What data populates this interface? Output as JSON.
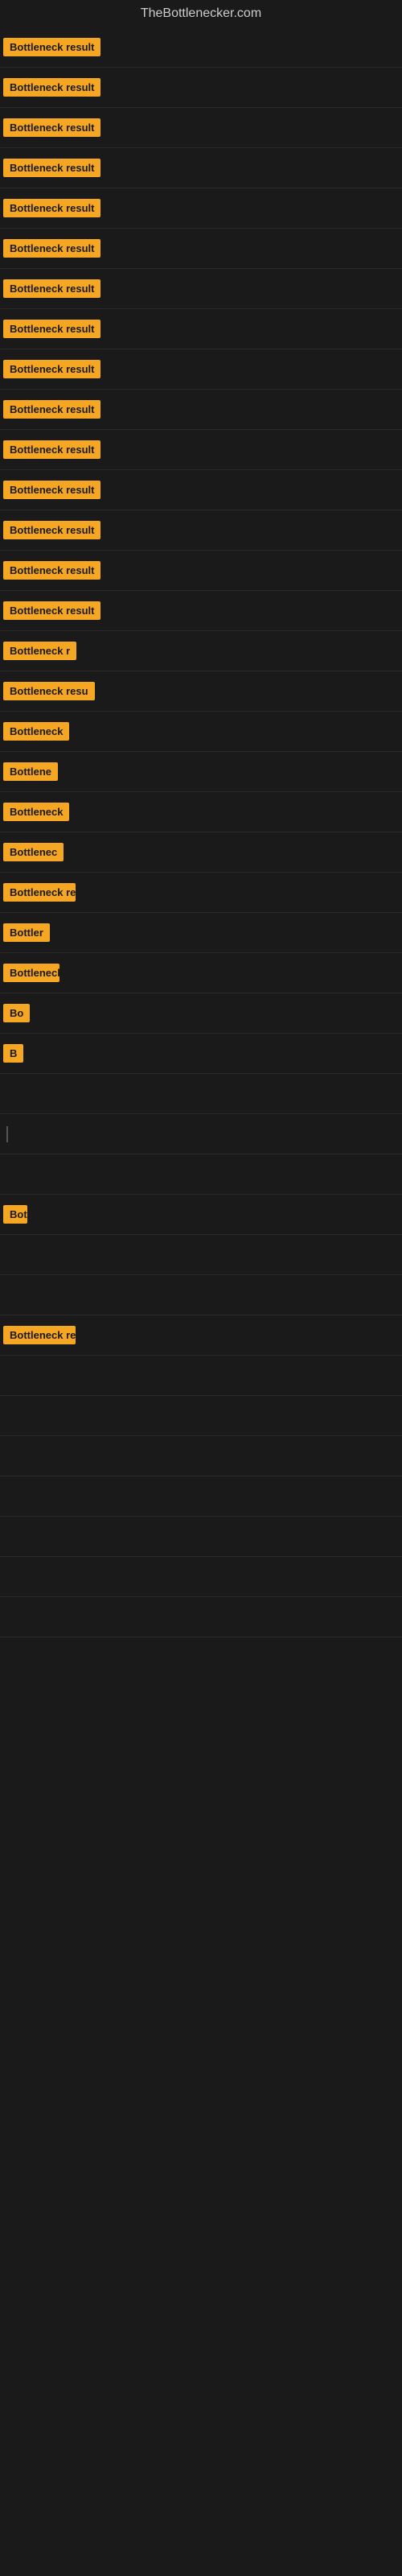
{
  "site": {
    "title": "TheBottlenecker.com"
  },
  "rows": [
    {
      "id": 1,
      "label": "Bottleneck result",
      "labelClass": "label-full",
      "barWidth": 0
    },
    {
      "id": 2,
      "label": "Bottleneck result",
      "labelClass": "label-full",
      "barWidth": 0
    },
    {
      "id": 3,
      "label": "Bottleneck result",
      "labelClass": "label-full",
      "barWidth": 0
    },
    {
      "id": 4,
      "label": "Bottleneck result",
      "labelClass": "label-full",
      "barWidth": 0
    },
    {
      "id": 5,
      "label": "Bottleneck result",
      "labelClass": "label-full",
      "barWidth": 0
    },
    {
      "id": 6,
      "label": "Bottleneck result",
      "labelClass": "label-full",
      "barWidth": 0
    },
    {
      "id": 7,
      "label": "Bottleneck result",
      "labelClass": "label-full",
      "barWidth": 0
    },
    {
      "id": 8,
      "label": "Bottleneck result",
      "labelClass": "label-full",
      "barWidth": 0
    },
    {
      "id": 9,
      "label": "Bottleneck result",
      "labelClass": "label-full",
      "barWidth": 0
    },
    {
      "id": 10,
      "label": "Bottleneck result",
      "labelClass": "label-full",
      "barWidth": 0
    },
    {
      "id": 11,
      "label": "Bottleneck result",
      "labelClass": "label-full",
      "barWidth": 0
    },
    {
      "id": 12,
      "label": "Bottleneck result",
      "labelClass": "label-full",
      "barWidth": 0
    },
    {
      "id": 13,
      "label": "Bottleneck result",
      "labelClass": "label-full",
      "barWidth": 0
    },
    {
      "id": 14,
      "label": "Bottleneck result",
      "labelClass": "label-full",
      "barWidth": 0
    },
    {
      "id": 15,
      "label": "Bottleneck result",
      "labelClass": "label-full",
      "barWidth": 0
    },
    {
      "id": 16,
      "label": "Bottleneck r",
      "labelClass": "label-w1",
      "barWidth": 0
    },
    {
      "id": 17,
      "label": "Bottleneck resu",
      "labelClass": "label-w2",
      "barWidth": 0
    },
    {
      "id": 18,
      "label": "Bottleneck",
      "labelClass": "label-w3",
      "barWidth": 0
    },
    {
      "id": 19,
      "label": "Bottlene",
      "labelClass": "label-w4",
      "barWidth": 0
    },
    {
      "id": 20,
      "label": "Bottleneck",
      "labelClass": "label-w3",
      "barWidth": 0
    },
    {
      "id": 21,
      "label": "Bottlenec",
      "labelClass": "label-w5",
      "barWidth": 0
    },
    {
      "id": 22,
      "label": "Bottleneck re",
      "labelClass": "label-w6",
      "barWidth": 0
    },
    {
      "id": 23,
      "label": "Bottler",
      "labelClass": "label-w7",
      "barWidth": 0
    },
    {
      "id": 24,
      "label": "Bottleneck",
      "labelClass": "label-w8",
      "barWidth": 0
    },
    {
      "id": 25,
      "label": "Bo",
      "labelClass": "label-w9",
      "barWidth": 0
    },
    {
      "id": 26,
      "label": "B",
      "labelClass": "label-w10",
      "barWidth": 0
    },
    {
      "id": 27,
      "label": "",
      "labelClass": "label-w11",
      "barWidth": 0
    },
    {
      "id": 28,
      "label": "",
      "labelClass": "label-w11",
      "barWidth": 0,
      "hasLine": true
    },
    {
      "id": 29,
      "label": "",
      "labelClass": "label-w11",
      "barWidth": 0
    },
    {
      "id": 30,
      "label": "Bot",
      "labelClass": "label-w12",
      "barWidth": 0
    },
    {
      "id": 31,
      "label": "",
      "labelClass": "label-w11",
      "barWidth": 0
    },
    {
      "id": 32,
      "label": "",
      "labelClass": "label-w11",
      "barWidth": 0
    },
    {
      "id": 33,
      "label": "Bottleneck re",
      "labelClass": "label-w6",
      "barWidth": 0
    },
    {
      "id": 34,
      "label": "",
      "labelClass": "label-w11",
      "barWidth": 0
    },
    {
      "id": 35,
      "label": "",
      "labelClass": "label-w11",
      "barWidth": 0
    },
    {
      "id": 36,
      "label": "",
      "labelClass": "label-w11",
      "barWidth": 0
    },
    {
      "id": 37,
      "label": "",
      "labelClass": "label-w11",
      "barWidth": 0
    },
    {
      "id": 38,
      "label": "",
      "labelClass": "label-w11",
      "barWidth": 0
    },
    {
      "id": 39,
      "label": "",
      "labelClass": "label-w11",
      "barWidth": 0
    },
    {
      "id": 40,
      "label": "",
      "labelClass": "label-w11",
      "barWidth": 0
    }
  ]
}
